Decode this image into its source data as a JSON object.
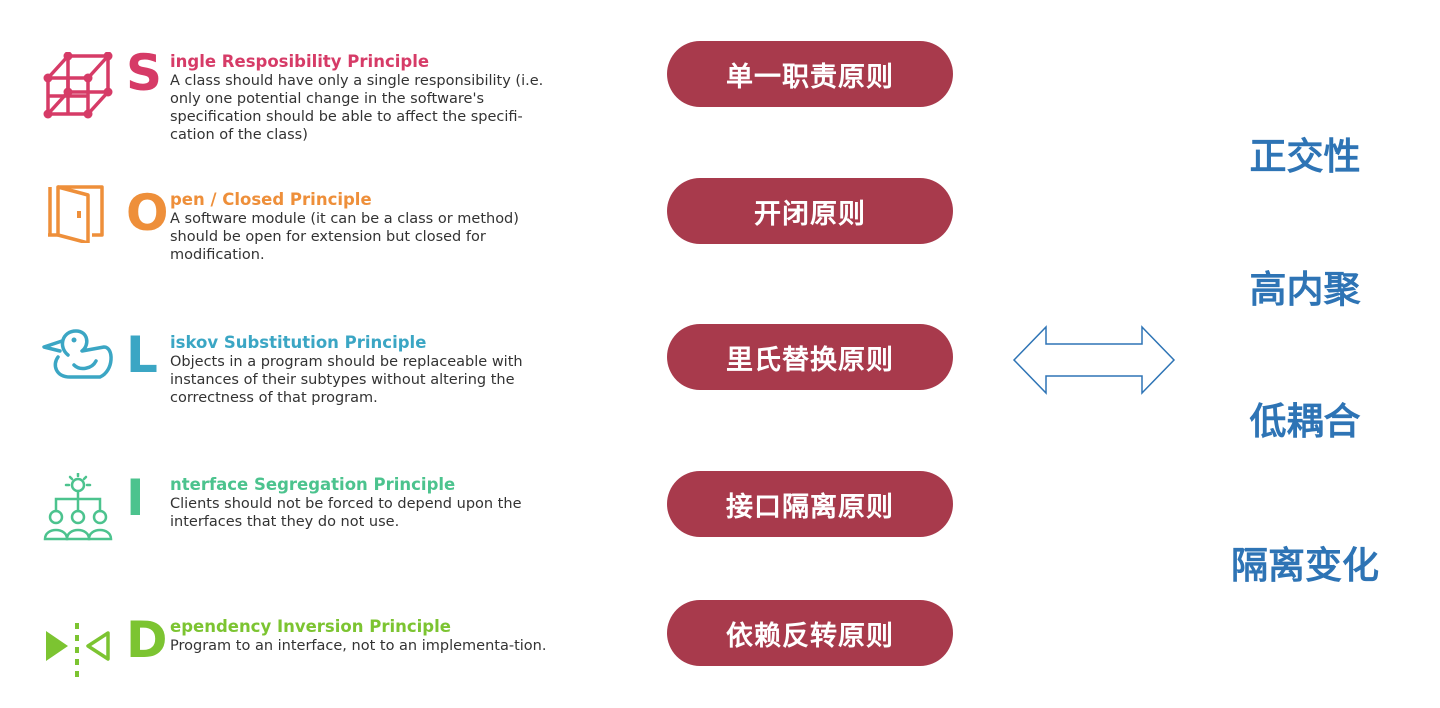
{
  "principles": [
    {
      "letter": "S",
      "title": "ingle Resposibility Principle",
      "desc": "A class should have only a single responsibility (i.e. only one potential change in the software's specification should be able to affect the specifi-cation of the class)",
      "color": "#D63B67",
      "icon": "cube-icon",
      "chinese": "单一职责原则"
    },
    {
      "letter": "O",
      "title": "pen / Closed Principle",
      "desc": "A software module (it can be a class or method) should be open for extension but closed for modification.",
      "color": "#EE8F3A",
      "icon": "door-icon",
      "chinese": "开闭原则"
    },
    {
      "letter": "L",
      "title": "iskov Substitution Principle",
      "desc": "Objects in a program should be replaceable with instances of their subtypes without altering the correctness of that program.",
      "color": "#3BA6C4",
      "icon": "duck-icon",
      "chinese": "里氏替换原则"
    },
    {
      "letter": "I",
      "title": "nterface Segregation Principle",
      "desc": "Clients should not be forced to depend upon the interfaces that they do not use.",
      "color": "#4CC38E",
      "icon": "people-idea-icon",
      "chinese": "接口隔离原则"
    },
    {
      "letter": "D",
      "title": "ependency Inversion Principle",
      "desc": "Program to an interface, not to an implementa-tion.",
      "color": "#7CC431",
      "icon": "inversion-icon",
      "chinese": "依赖反转原则"
    }
  ],
  "arrow": "double-arrow-icon",
  "properties": [
    "正交性",
    "高内聚",
    "低耦合",
    "隔离变化"
  ],
  "colors": {
    "pill": "#A83A4C",
    "property_text": "#2E74B5",
    "arrow_stroke": "#2E74B5"
  }
}
